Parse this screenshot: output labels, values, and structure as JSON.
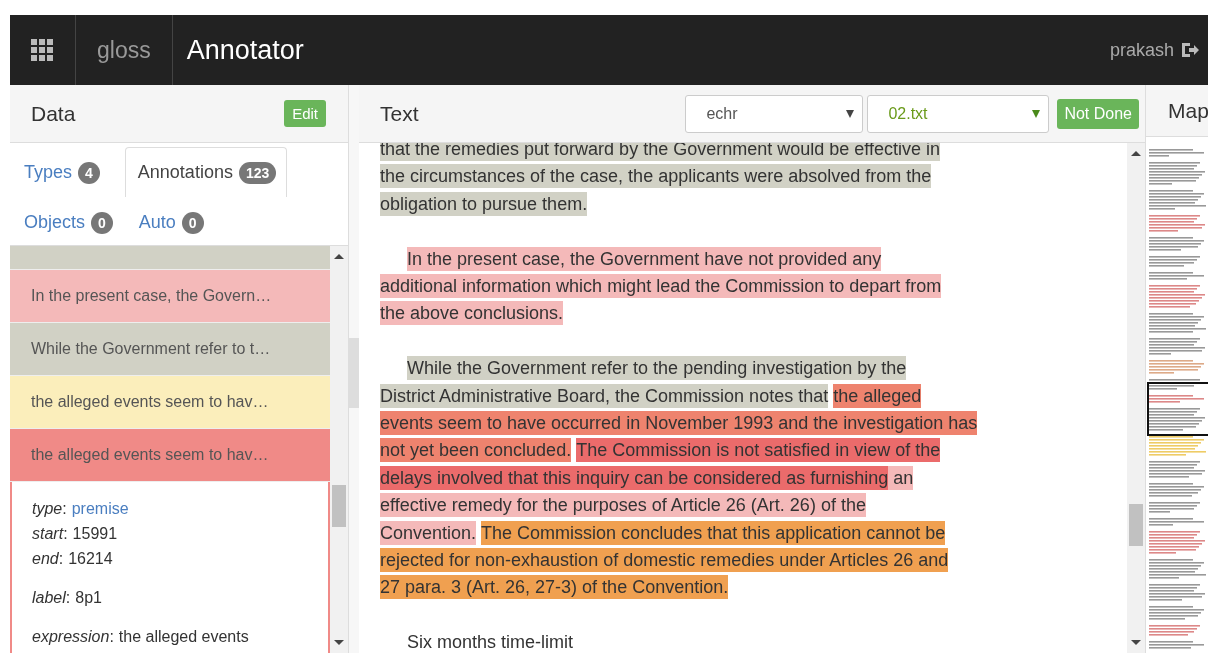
{
  "navbar": {
    "brand": "gloss",
    "title": "Annotator",
    "user": "prakash"
  },
  "data_panel": {
    "title": "Data",
    "edit_button": "Edit",
    "tabs": [
      {
        "label": "Types",
        "count": "4",
        "selected": false
      },
      {
        "label": "Annotations",
        "count": "123",
        "selected": true
      },
      {
        "label": "Objects",
        "count": "0",
        "selected": false
      },
      {
        "label": "Auto",
        "count": "0",
        "selected": false
      }
    ],
    "annotations": [
      {
        "color": "#d1d1c5"
      },
      {
        "text": "In the present case, the Govern…",
        "color": "#f4b9b9"
      },
      {
        "text": "While the Government refer to t…",
        "color": "#d1d1c5"
      },
      {
        "text": "the alleged events seem to hav…",
        "color": "#fbeebb"
      },
      {
        "text": "the alleged events seem to hav…",
        "color": "#f08a87",
        "expanded": true
      }
    ],
    "details": [
      [
        {
          "key": "*type*:",
          "value": "premise",
          "kind": "link"
        },
        {
          "key": "*start*:",
          "value": "15991",
          "kind": "plain"
        },
        {
          "key": "*end*:",
          "value": "16214",
          "kind": "plain"
        }
      ],
      [
        {
          "key": "*label*:",
          "value": "8p1",
          "kind": "plain"
        }
      ],
      [
        {
          "key": "*expression*:",
          "value": "the alleged events",
          "kind": "plain"
        }
      ]
    ]
  },
  "text_panel": {
    "title": "Text",
    "corpus": "echr",
    "document": "02.txt",
    "status_button": "Not Done",
    "paragraphs": [
      {
        "indent": false,
        "lines": [
          [
            {
              "text": "that the remedies put forward by the Government would be effective in",
              "color": "#d1d1c5"
            }
          ],
          [
            {
              "text": "the circumstances of the case, the applicants were absolved from the",
              "color": "#d1d1c5"
            }
          ],
          [
            {
              "text": "obligation to pursue them.",
              "color": "#d1d1c5"
            }
          ]
        ]
      },
      {
        "indent": true,
        "lines": [
          [
            {
              "text": "In the present case, the Government have not provided any",
              "color": "#f4b9b9"
            }
          ],
          [
            {
              "text": "additional information which might lead the Commission to depart from",
              "color": "#f4b9b9"
            }
          ],
          [
            {
              "text": "the above conclusions.",
              "color": "#f4b9b9"
            }
          ]
        ]
      },
      {
        "indent": true,
        "lines": [
          [
            {
              "text": "While the Government refer to the pending investigation by the",
              "color": "#d1d1c5"
            }
          ],
          [
            {
              "text": "District Administrative Board, the Commission notes that",
              "color": "#d1d1c5"
            },
            {
              "text": "the alleged",
              "color": "#ee836e",
              "gap": true
            }
          ],
          [
            {
              "text": "events seem to have occurred in November 1993 and the investigation has",
              "color": "#ee836e"
            }
          ],
          [
            {
              "text": "not yet been concluded.",
              "color": "#ee836e"
            },
            {
              "text": "The Commission is not satisfied in view of the",
              "color": "#eb6b6b",
              "gap": true
            }
          ],
          [
            {
              "text": "delays involved that this inquiry can be considered as furnishing",
              "color": "#eb6b6b"
            },
            {
              "text": " an",
              "color": "#f4b9b9"
            }
          ],
          [
            {
              "text": "effective remedy for the purposes of Article 26 (Art. 26) of the",
              "color": "#f4b9b9"
            }
          ],
          [
            {
              "text": "Convention.",
              "color": "#f4b9b9"
            },
            {
              "text": "The Commission concludes that this application cannot be",
              "color": "#f0a050",
              "gap": true
            }
          ],
          [
            {
              "text": "rejected for non-exhaustion of domestic remedies under Articles 26 and",
              "color": "#f0a050"
            }
          ],
          [
            {
              "text": "27 para. 3 (Art. 26, 27-3) of the Convention.",
              "color": "#f0a050"
            }
          ]
        ]
      },
      {
        "indent": true,
        "lines": [
          [
            {
              "text": "Six months time-limit"
            }
          ]
        ]
      }
    ]
  },
  "map_panel": {
    "title": "Map"
  }
}
